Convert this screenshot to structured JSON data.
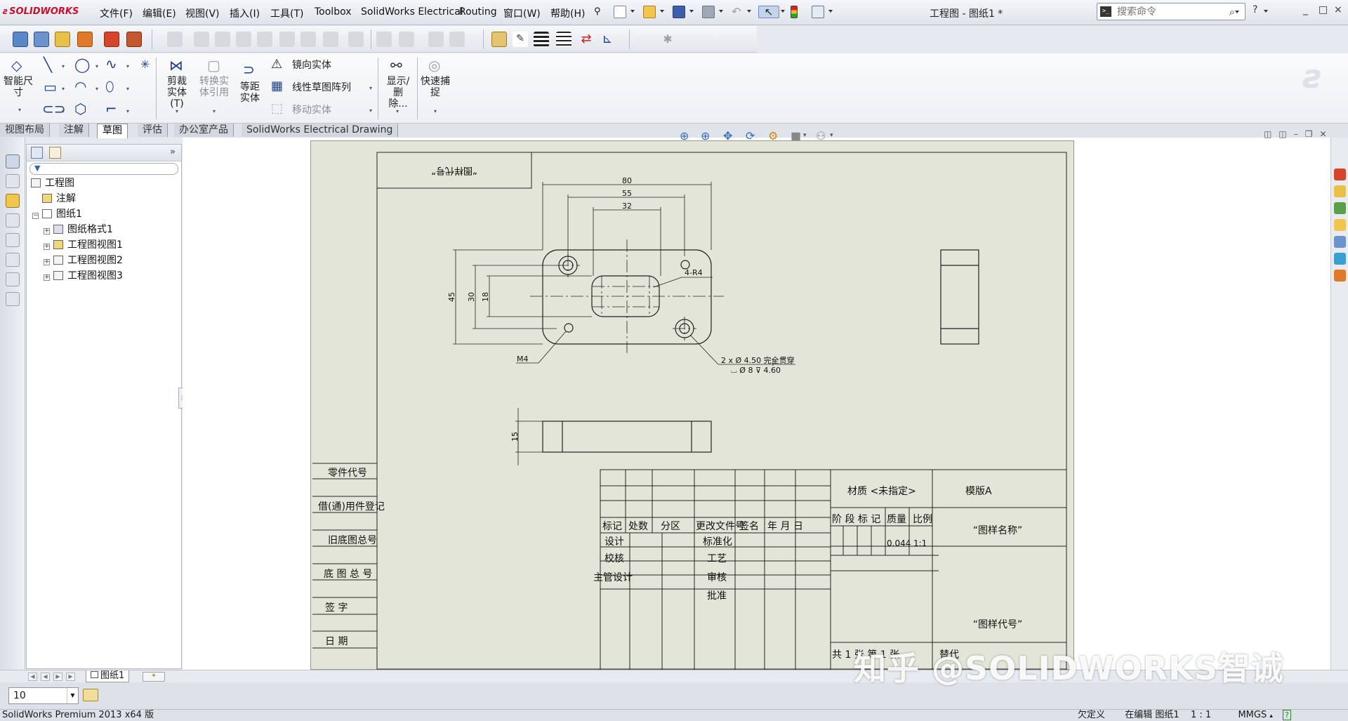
{
  "menubar": {
    "logo": "SOLIDWORKS",
    "items": [
      "文件(F)",
      "编辑(E)",
      "视图(V)",
      "插入(I)",
      "工具(T)",
      "Toolbox",
      "SolidWorks Electrical",
      "Routing",
      "窗口(W)",
      "帮助(H)"
    ],
    "doc_title": "工程图 - 图纸1 *",
    "search_placeholder": "搜索命令",
    "help": "?",
    "window_controls": [
      "_",
      "□",
      "×"
    ]
  },
  "command_manager": {
    "smart_dim": "智能尺寸",
    "trim": "剪裁实体(T)",
    "convert": "转换实体引用",
    "offset": "等距实体",
    "mirror": "镜向实体",
    "linear_pattern": "线性草图阵列",
    "move": "移动实体",
    "display_delete": "显示/删除...",
    "quick_snap": "快速捕捉"
  },
  "tabs": [
    "视图布局",
    "注解",
    "草图",
    "评估",
    "办公室产品",
    "SolidWorks Electrical Drawing"
  ],
  "active_tab": "草图",
  "tree": {
    "root": "工程图",
    "annotations": "注解",
    "sheet": "图纸1",
    "children": [
      "图纸格式1",
      "工程图视图1",
      "工程图视图2",
      "工程图视图3"
    ]
  },
  "drawing": {
    "top_left_box": "“图样代号”",
    "dims": {
      "d80": "80",
      "d55": "55",
      "d32": "32",
      "d45": "45",
      "d30": "30",
      "d18": "18",
      "d15": "15",
      "r4": "4-R4",
      "m4": "M4",
      "hole1": "2 x  Ø 4.50 完全贯穿",
      "hole2": "⌴ Ø 8  ⊽ 4.60"
    },
    "left_cells": [
      "零件代号",
      "借(通)用件登记",
      "旧底图总号",
      "底 图 总 号",
      "签    字",
      "日    期"
    ],
    "title_block": {
      "material": "材质 <未指定>",
      "template": "模版A",
      "header_row": [
        "标记",
        "处数",
        "分区",
        "更改文件号",
        "签名",
        "年 月 日"
      ],
      "design": "设计",
      "check": "校核",
      "chief": "主管设计",
      "standard": "标准化",
      "process": "工艺",
      "review": "审核",
      "approve": "批准",
      "stage_label": "阶 段 标 记",
      "mass_label": "质量",
      "scale_label": "比例",
      "mass": "0.044",
      "scale": "1:1",
      "name": "“图样名称”",
      "code": "“图样代号”",
      "sheets": "共 1 张 第 1 张",
      "replace": "替代"
    }
  },
  "bottom": {
    "sheet_tab": "图纸1",
    "layer_value": "10",
    "product": "SolidWorks Premium 2013 x64 版",
    "status_undefined": "欠定义",
    "status_editing": "在编辑 图纸1",
    "status_scale": "1 : 1",
    "status_units": "MMGS",
    "status_help": "?"
  },
  "watermark": "知乎 @SOLIDWORKS智诚"
}
